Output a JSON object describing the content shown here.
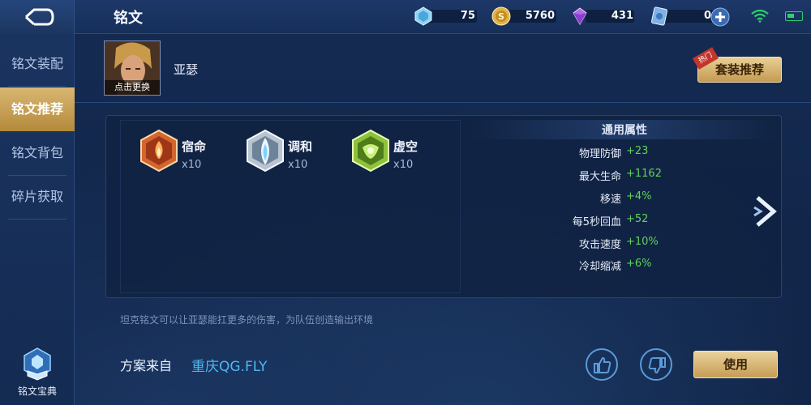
{
  "header": {
    "title": "铭文",
    "resources": [
      {
        "icon": "diamond-icon",
        "value": "75"
      },
      {
        "icon": "gold-coin-icon",
        "value": "5760"
      },
      {
        "icon": "crystal-icon",
        "value": "431"
      },
      {
        "icon": "voucher-icon",
        "value": "0"
      }
    ]
  },
  "sidebar": {
    "items": [
      {
        "label": "铭文装配"
      },
      {
        "label": "铭文推荐"
      },
      {
        "label": "铭文背包"
      },
      {
        "label": "碎片获取"
      }
    ],
    "codex_label": "铭文宝典"
  },
  "hero": {
    "caption": "点击更换",
    "name": "亚瑟"
  },
  "set_recommend": {
    "tag": "热门",
    "label": "套装推荐"
  },
  "runes": [
    {
      "name": "宿命",
      "count": "x10",
      "color": "#d2662e"
    },
    {
      "name": "调和",
      "count": "x10",
      "color": "#b8c4cf"
    },
    {
      "name": "虚空",
      "count": "x10",
      "color": "#8ec23b"
    }
  ],
  "stats": {
    "title": "通用属性",
    "rows": [
      {
        "key": "物理防御",
        "value": "+23"
      },
      {
        "key": "最大生命",
        "value": "+1162"
      },
      {
        "key": "移速",
        "value": "+4%"
      },
      {
        "key": "每5秒回血",
        "value": "+52"
      },
      {
        "key": "攻击速度",
        "value": "+10%"
      },
      {
        "key": "冷却缩减",
        "value": "+6%"
      }
    ]
  },
  "description": "坦克铭文可以让亚瑟能扛更多的伤害，为队伍创造输出环境",
  "author": {
    "label": "方案来自",
    "name": "重庆QG.FLY"
  },
  "use_label": "使用",
  "colors": {
    "accent_gold": "#c49b52",
    "stat_green": "#5fd35a",
    "author_blue": "#4db8f2"
  }
}
